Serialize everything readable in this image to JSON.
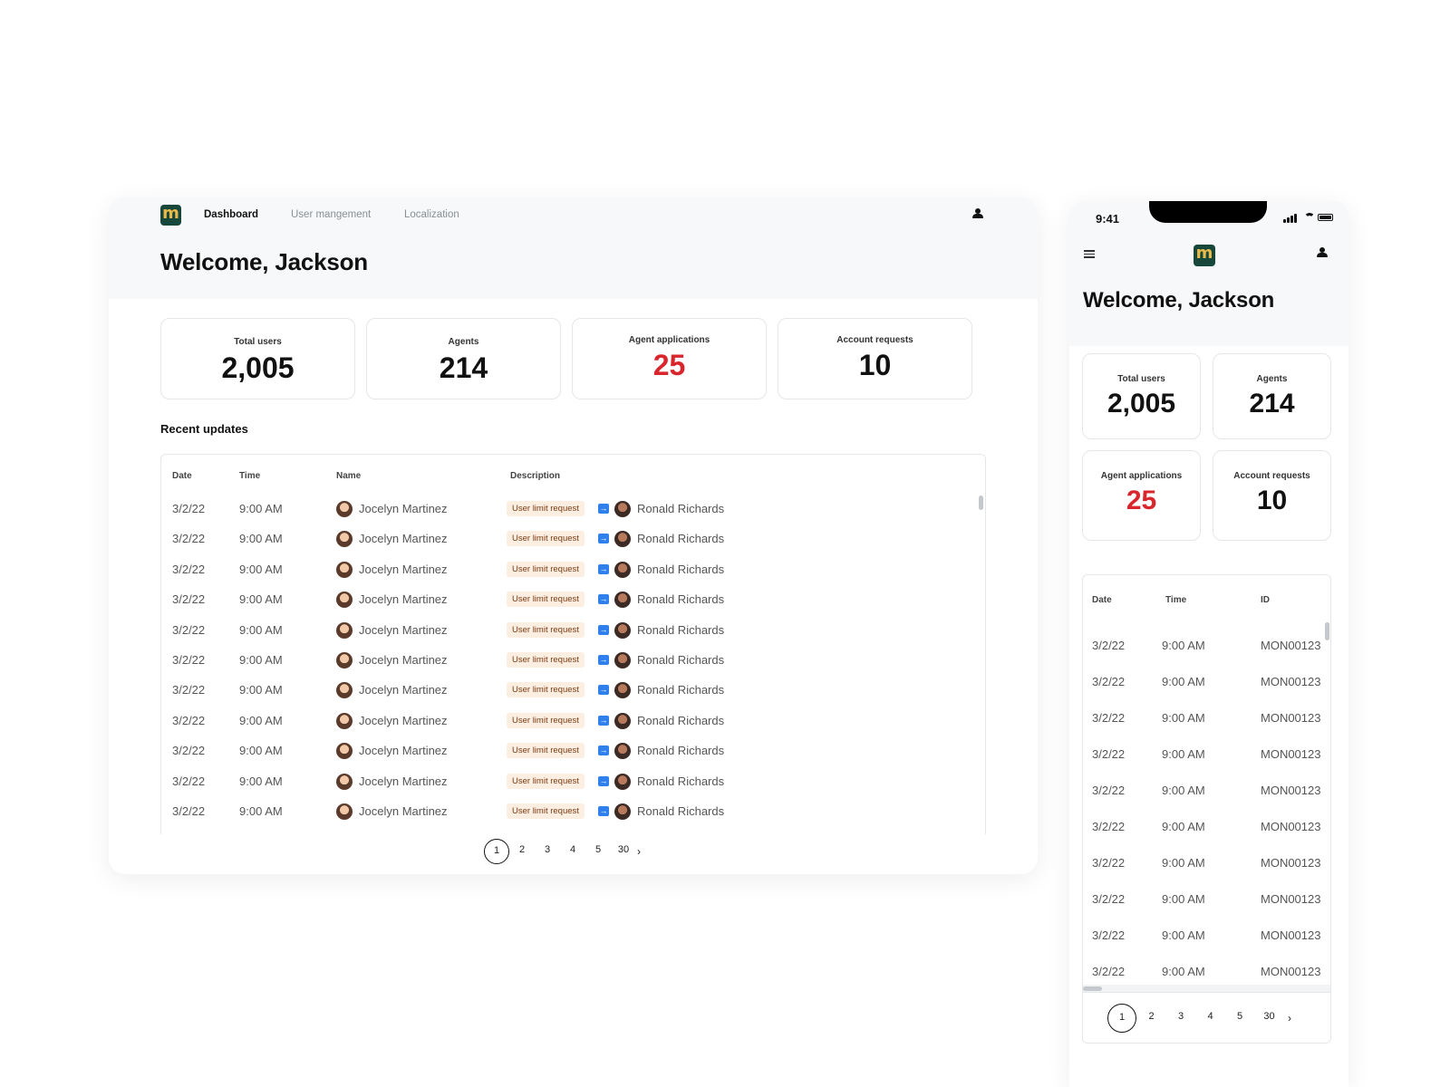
{
  "nav": {
    "logo_letter": "m",
    "items": [
      "Dashboard",
      "User mangement",
      "Localization"
    ],
    "active": "Dashboard"
  },
  "welcome": "Welcome, Jackson",
  "stats": [
    {
      "label": "Total users",
      "value": "2,005"
    },
    {
      "label": "Agents",
      "value": "214"
    },
    {
      "label": "Agent applications",
      "value": "25"
    },
    {
      "label": "Account requests",
      "value": "10"
    }
  ],
  "recent_title": "Recent updates",
  "desktop_table": {
    "headers": [
      "Date",
      "Time",
      "Name",
      "Description"
    ],
    "rows": [
      {
        "date": "3/2/22",
        "time": "9:00 AM",
        "name": "Jocelyn Martinez",
        "badge": "User limit request",
        "target": "Ronald Richards"
      },
      {
        "date": "3/2/22",
        "time": "9:00 AM",
        "name": "Jocelyn Martinez",
        "badge": "User limit request",
        "target": "Ronald Richards"
      },
      {
        "date": "3/2/22",
        "time": "9:00 AM",
        "name": "Jocelyn Martinez",
        "badge": "User limit request",
        "target": "Ronald Richards"
      },
      {
        "date": "3/2/22",
        "time": "9:00 AM",
        "name": "Jocelyn Martinez",
        "badge": "User limit request",
        "target": "Ronald Richards"
      },
      {
        "date": "3/2/22",
        "time": "9:00 AM",
        "name": "Jocelyn Martinez",
        "badge": "User limit request",
        "target": "Ronald Richards"
      },
      {
        "date": "3/2/22",
        "time": "9:00 AM",
        "name": "Jocelyn Martinez",
        "badge": "User limit request",
        "target": "Ronald Richards"
      },
      {
        "date": "3/2/22",
        "time": "9:00 AM",
        "name": "Jocelyn Martinez",
        "badge": "User limit request",
        "target": "Ronald Richards"
      },
      {
        "date": "3/2/22",
        "time": "9:00 AM",
        "name": "Jocelyn Martinez",
        "badge": "User limit request",
        "target": "Ronald Richards"
      },
      {
        "date": "3/2/22",
        "time": "9:00 AM",
        "name": "Jocelyn Martinez",
        "badge": "User limit request",
        "target": "Ronald Richards"
      },
      {
        "date": "3/2/22",
        "time": "9:00 AM",
        "name": "Jocelyn Martinez",
        "badge": "User limit request",
        "target": "Ronald Richards"
      },
      {
        "date": "3/2/22",
        "time": "9:00 AM",
        "name": "Jocelyn Martinez",
        "badge": "User limit request",
        "target": "Ronald Richards"
      }
    ]
  },
  "pagination": {
    "pages": [
      "1",
      "2",
      "3",
      "4",
      "5",
      "30"
    ],
    "current": "1",
    "next_icon": "chevron-right-icon"
  },
  "mobile": {
    "status_time": "9:41",
    "table": {
      "headers": [
        "Date",
        "Time",
        "ID"
      ],
      "rows": [
        {
          "date": "3/2/22",
          "time": "9:00 AM",
          "id": "MON00123"
        },
        {
          "date": "3/2/22",
          "time": "9:00 AM",
          "id": "MON00123"
        },
        {
          "date": "3/2/22",
          "time": "9:00 AM",
          "id": "MON00123"
        },
        {
          "date": "3/2/22",
          "time": "9:00 AM",
          "id": "MON00123"
        },
        {
          "date": "3/2/22",
          "time": "9:00 AM",
          "id": "MON00123"
        },
        {
          "date": "3/2/22",
          "time": "9:00 AM",
          "id": "MON00123"
        },
        {
          "date": "3/2/22",
          "time": "9:00 AM",
          "id": "MON00123"
        },
        {
          "date": "3/2/22",
          "time": "9:00 AM",
          "id": "MON00123"
        },
        {
          "date": "3/2/22",
          "time": "9:00 AM",
          "id": "MON00123"
        },
        {
          "date": "3/2/22",
          "time": "9:00 AM",
          "id": "MON00123"
        }
      ]
    }
  },
  "colors": {
    "brand": "#16473a",
    "logo_accent": "#e9b949",
    "alert": "#d9252c",
    "badge_bg": "#fdeee2",
    "arrow": "#2f80ed"
  }
}
